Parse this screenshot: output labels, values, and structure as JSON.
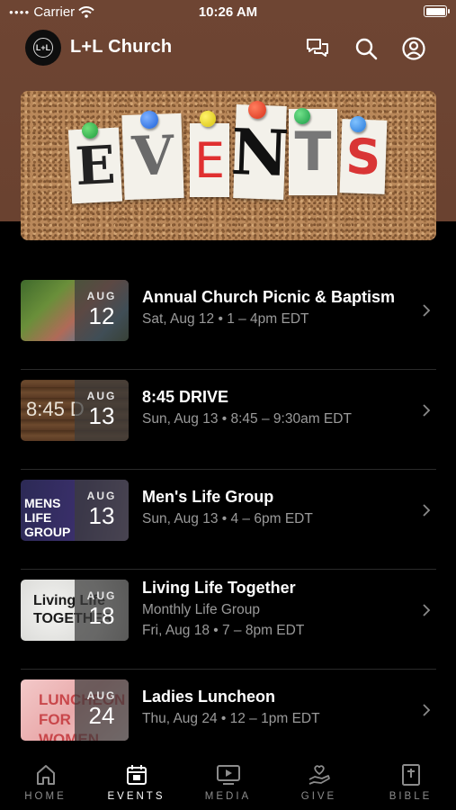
{
  "status_bar": {
    "carrier": "Carrier",
    "time": "10:26 AM"
  },
  "header": {
    "title": "L+L Church",
    "logo_text": "L+L"
  },
  "banner": {
    "letters": [
      "E",
      "V",
      "E",
      "N",
      "T",
      "S"
    ]
  },
  "events": [
    {
      "title": "Annual Church Picnic & Baptism",
      "lines": [
        "Sat, Aug 12 • 1 – 4pm EDT"
      ],
      "month": "AUG",
      "day": "12",
      "thumb_text": "",
      "thumb_style": "picnic"
    },
    {
      "title": "8:45 DRIVE",
      "lines": [
        "Sun, Aug 13 • 8:45 – 9:30am EDT"
      ],
      "month": "AUG",
      "day": "13",
      "thumb_text": "8:45 D",
      "thumb_style": "wood"
    },
    {
      "title": "Men's Life Group",
      "lines": [
        "Sun, Aug 13 • 4 – 6pm EDT"
      ],
      "month": "AUG",
      "day": "13",
      "thumb_text": "MENS LIFE GROUP",
      "thumb_style": "purple"
    },
    {
      "title": "Living Life Together",
      "lines": [
        "Monthly Life Group",
        "Fri, Aug 18 • 7 – 8pm EDT"
      ],
      "month": "AUG",
      "day": "18",
      "thumb_text": "Living Life TOGETHER",
      "thumb_style": "light"
    },
    {
      "title": "Ladies Luncheon",
      "lines": [
        "Thu, Aug 24 • 12 – 1pm EDT"
      ],
      "month": "AUG",
      "day": "24",
      "thumb_text": "LUNCHEON FOR WOMEN",
      "thumb_style": "pink"
    }
  ],
  "tabs": [
    {
      "label": "HOME",
      "icon": "home-icon",
      "active": false
    },
    {
      "label": "EVENTS",
      "icon": "calendar-icon",
      "active": true
    },
    {
      "label": "MEDIA",
      "icon": "play-screen-icon",
      "active": false
    },
    {
      "label": "GIVE",
      "icon": "hand-heart-icon",
      "active": false
    },
    {
      "label": "BIBLE",
      "icon": "bible-icon",
      "active": false
    }
  ],
  "colors": {
    "header_bg": "#6e4533",
    "background": "#000000",
    "active_tab": "#ffffff",
    "inactive_tab": "#8c8c8c"
  }
}
